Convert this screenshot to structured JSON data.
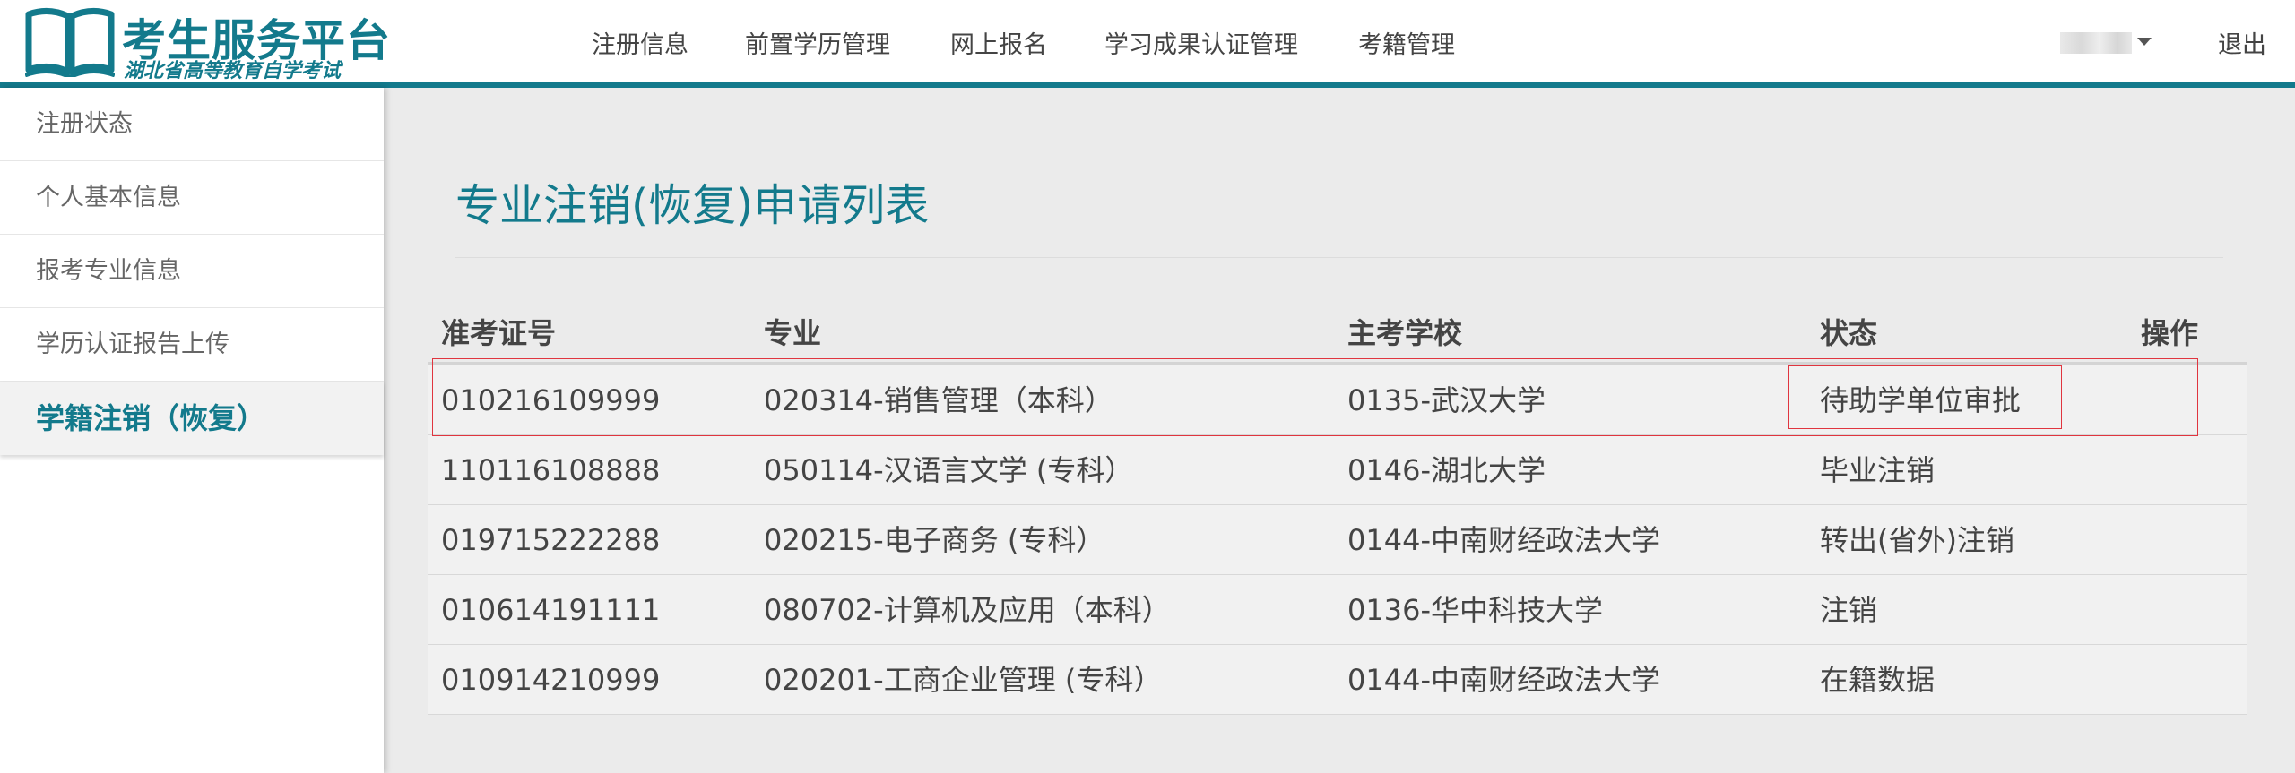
{
  "header": {
    "logo_title": "考生服务平台",
    "logo_subtitle": "湖北省高等教育自学考试",
    "nav": [
      "注册信息",
      "前置学历管理",
      "网上报名",
      "学习成果认证管理",
      "考籍管理"
    ],
    "logout": "退出"
  },
  "sidebar": {
    "items": [
      "注册状态",
      "个人基本信息",
      "报考专业信息",
      "学历认证报告上传",
      "学籍注销（恢复）"
    ],
    "active_index": 4
  },
  "main": {
    "title": "专业注销(恢复)申请列表",
    "columns": [
      "准考证号",
      "专业",
      "主考学校",
      "状态",
      "操作"
    ],
    "rows": [
      {
        "ticket": "010216109999",
        "major": "020314-销售管理（本科）",
        "school": "0135-武汉大学",
        "status": "待助学单位审批",
        "action": ""
      },
      {
        "ticket": "110116108888",
        "major": "050114-汉语言文学 (专科）",
        "school": "0146-湖北大学",
        "status": "毕业注销",
        "action": ""
      },
      {
        "ticket": "019715222288",
        "major": "020215-电子商务 (专科）",
        "school": "0144-中南财经政法大学",
        "status": "转出(省外)注销",
        "action": ""
      },
      {
        "ticket": "010614191111",
        "major": "080702-计算机及应用（本科）",
        "school": "0136-华中科技大学",
        "status": "注销",
        "action": ""
      },
      {
        "ticket": "010914210999",
        "major": "020201-工商企业管理 (专科）",
        "school": "0144-中南财经政法大学",
        "status": "在籍数据",
        "action": ""
      }
    ]
  },
  "colors": {
    "accent": "#137a8c",
    "highlight": "#e0353f"
  }
}
